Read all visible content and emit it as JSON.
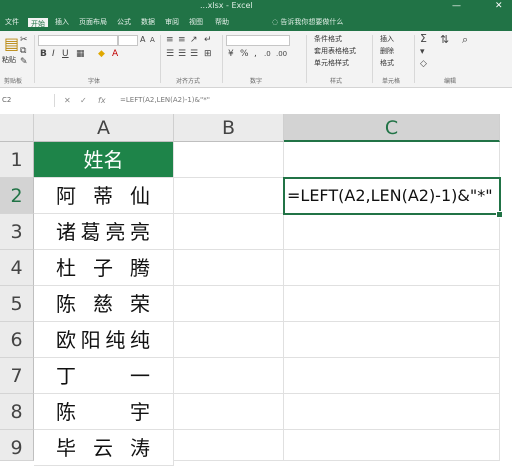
{
  "title_bar": {
    "title": "...xlsx - Excel",
    "min": "—",
    "close": "✕"
  },
  "tabs": [
    "文件",
    "开始",
    "插入",
    "页面布局",
    "公式",
    "数据",
    "审阅",
    "视图",
    "帮助"
  ],
  "active_tab": "开始",
  "tell_me": "告诉我你想要做什么",
  "ribbon": {
    "paste": "粘贴",
    "clipboard_label": "剪贴板",
    "font_label": "字体",
    "align_label": "对齐方式",
    "number_label": "数字",
    "styles_label": "样式",
    "cells_label": "单元格",
    "edit_label": "编辑",
    "cond_format": "条件格式",
    "table_format": "套用表格格式",
    "cell_styles": "单元格样式",
    "insert": "插入",
    "delete": "删除",
    "format": "格式"
  },
  "formula_bar": {
    "name_box": "C2",
    "formula": "=LEFT(A2,LEN(A2)-1)&\"*\""
  },
  "columns": [
    "A",
    "B",
    "C"
  ],
  "selected_column": "C",
  "rows": [
    "1",
    "2",
    "3",
    "4",
    "5",
    "6",
    "7",
    "8",
    "9"
  ],
  "selected_row": "2",
  "header_cell": "姓名",
  "names": [
    "阿蒂仙",
    "诸葛亮亮",
    "杜子腾",
    "陈慈荣",
    "欧阳纯纯",
    "丁一",
    "陈宇",
    "毕云涛"
  ],
  "c2_value": "=LEFT(A2,LEN(A2)-1)&\"*\"",
  "colors": {
    "excel_green": "#217346",
    "header_fill": "#1e8449"
  }
}
